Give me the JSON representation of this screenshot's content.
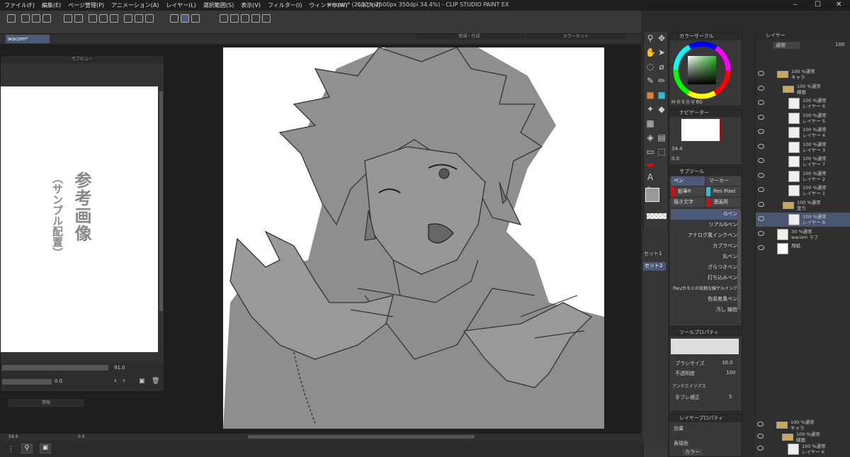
{
  "window": {
    "title": "wacom* (2500 x 2500px 350dpi 34.4%) - CLIP STUDIO PAINT EX",
    "menus": [
      "ファイル(F)",
      "編集(E)",
      "ページ管理(P)",
      "アニメーション(A)",
      "レイヤー(L)",
      "選択範囲(S)",
      "表示(V)",
      "フィルター(I)",
      "ウィンドウ(W)",
      "ヘルプ(H)"
    ],
    "document_tab": "wacom*"
  },
  "subview": {
    "title": "サブビュー",
    "ref_title": "参考画像",
    "ref_subtitle": "（サンプル配置）",
    "zoom": "91.0",
    "angle": "0.0"
  },
  "floating_tabs": {
    "left": "新規・作成",
    "right": "カラーセット"
  },
  "info_panel": {
    "title": "情報"
  },
  "navigator_bar": {
    "zoom": "34.4",
    "angle": "0.0"
  },
  "color_panel": {
    "title": "カラーサークル",
    "h": "0",
    "s": "0",
    "v": "60"
  },
  "navigator": {
    "title": "ナビゲーター",
    "zoom": "34.4",
    "angle": "0.0"
  },
  "subtool": {
    "title": "サブツール",
    "groups": [
      "ペン",
      "マーカー",
      "鉛筆R",
      "Pen Pixel",
      "描き文字",
      "漫画用"
    ],
    "brushes": [
      "Gペン",
      "リアルGペン",
      "アナログ風インクペン",
      "カブラペン",
      "丸ペン",
      "ざらつきペン",
      "打ち込みペン",
      "Pen/カモミの気軽な線ゲルインク",
      "色収差風ペン",
      "汚し 線拍"
    ]
  },
  "subtool_sets": {
    "items": [
      "セット1",
      "セット2"
    ]
  },
  "tool_property": {
    "title": "ツールプロパティ",
    "brush_size_label": "ブラシサイズ",
    "brush_size": "30.0",
    "opacity_label": "不透明度",
    "opacity": "100",
    "antialias_label": "アンチエイリアス",
    "stabilization_label": "手ブレ補正",
    "stabilization": "5"
  },
  "layer_property": {
    "title": "レイヤープロパティ",
    "effect_label": "効果",
    "color_label": "表現色",
    "color_value": "カラー"
  },
  "layers": {
    "title": "レイヤー",
    "blend_mode": "通常",
    "opacity": "100",
    "items": [
      {
        "line1": "100 %通常",
        "line2": "キャラ",
        "type": "folder",
        "indent": 0
      },
      {
        "line1": "100 %通常",
        "line2": "線画",
        "type": "folder",
        "indent": 1
      },
      {
        "line1": "100 %通常",
        "line2": "レイヤー 6",
        "type": "layer",
        "indent": 2
      },
      {
        "line1": "100 %通常",
        "line2": "レイヤー 5",
        "type": "layer",
        "indent": 2
      },
      {
        "line1": "100 %通常",
        "line2": "レイヤー 4",
        "type": "layer",
        "indent": 2
      },
      {
        "line1": "100 %通常",
        "line2": "レイヤー 3",
        "type": "layer",
        "indent": 2
      },
      {
        "line1": "100 %通常",
        "line2": "レイヤー 7",
        "type": "layer",
        "indent": 2
      },
      {
        "line1": "100 %通常",
        "line2": "レイヤー 2",
        "type": "layer",
        "indent": 2
      },
      {
        "line1": "100 %通常",
        "line2": "レイヤー 1",
        "type": "layer",
        "indent": 2
      },
      {
        "line1": "100 %通常",
        "line2": "塗り",
        "type": "folder",
        "indent": 1
      },
      {
        "line1": "100 %通常",
        "line2": "レイヤー 8",
        "type": "layer",
        "indent": 2,
        "selected": true
      },
      {
        "line1": "30 %通常",
        "line2": "wacom ラフ",
        "type": "layer",
        "indent": 0
      },
      {
        "line1": "",
        "line2": "用紙",
        "type": "paper",
        "indent": 0
      }
    ],
    "second": [
      {
        "line1": "100 %通常",
        "line2": "キャラ"
      },
      {
        "line1": "100 %通常",
        "line2": "線画"
      },
      {
        "line1": "100 %通常",
        "line2": "レイヤー 6"
      }
    ]
  },
  "colors": {
    "accent": "#4a5a78",
    "red": "#d01010",
    "cyan": "#38b8d0"
  }
}
